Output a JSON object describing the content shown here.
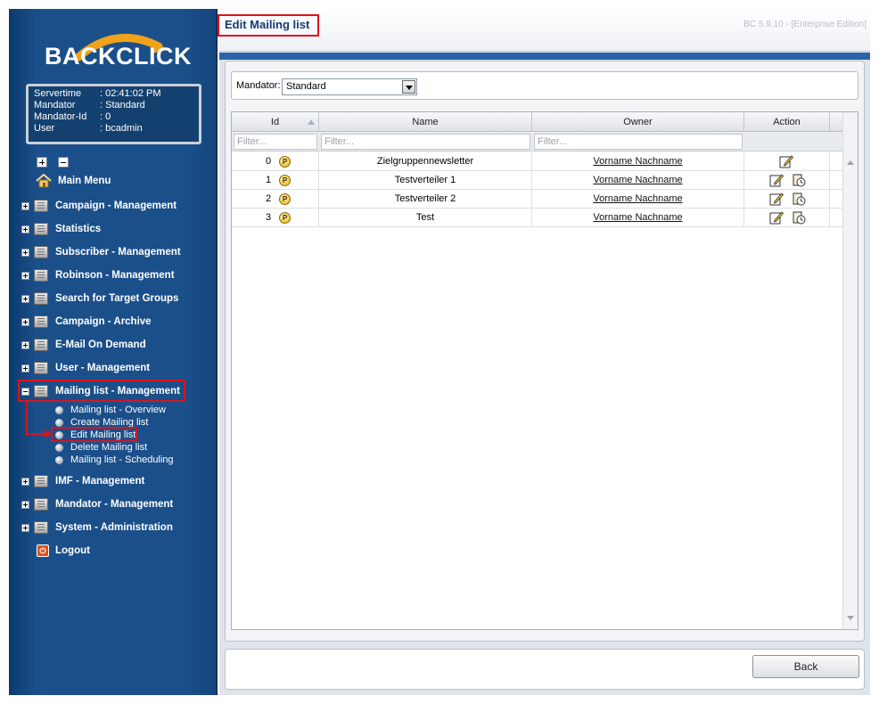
{
  "app": {
    "logo_text": "BACKCLICK",
    "version": "BC 5.9.10 - [Enterprise Edition]"
  },
  "server_info": [
    {
      "key": "Servertime",
      "value": ": 02:41:02 PM"
    },
    {
      "key": "Mandator",
      "value": ": Standard"
    },
    {
      "key": "Mandator-Id",
      "value": ": 0"
    },
    {
      "key": "User",
      "value": ": bcadmin"
    }
  ],
  "nav": {
    "main_menu": "Main Menu",
    "campaign_management": "Campaign - Management",
    "statistics": "Statistics",
    "subscriber_management": "Subscriber - Management",
    "robinson_management": "Robinson - Management",
    "search_target_groups": "Search for Target Groups",
    "campaign_archive": "Campaign - Archive",
    "email_on_demand": "E-Mail On Demand",
    "user_management": "User - Management",
    "mailing_list_management": "Mailing list - Management",
    "mailing_sub": [
      "Mailing list - Overview",
      "Create Mailing list",
      "Edit Mailing list",
      "Delete Mailing list",
      "Mailing list - Scheduling"
    ],
    "imf_management": "IMF - Management",
    "mandator_management": "Mandator - Management",
    "system_administration": "System - Administration",
    "logout": "Logout"
  },
  "page": {
    "title": "Edit Mailing list",
    "mandator_label": "Mandator:",
    "mandator_value": "Standard"
  },
  "grid": {
    "columns": [
      "Id",
      "Name",
      "Owner",
      "Action"
    ],
    "filter_placeholder": "Filter...",
    "rows": [
      {
        "id": "0",
        "name": "Zielgruppennewsletter",
        "owner": "Vorname Nachname"
      },
      {
        "id": "1",
        "name": "Testverteiler 1",
        "owner": "Vorname Nachname"
      },
      {
        "id": "2",
        "name": "Testverteiler 2",
        "owner": "Vorname Nachname"
      },
      {
        "id": "3",
        "name": "Test",
        "owner": "Vorname Nachname"
      }
    ]
  },
  "buttons": {
    "back": "Back"
  },
  "colors": {
    "sidebar": "#1b4f8a",
    "highlight": "#e0111a",
    "title": "#153a73"
  }
}
